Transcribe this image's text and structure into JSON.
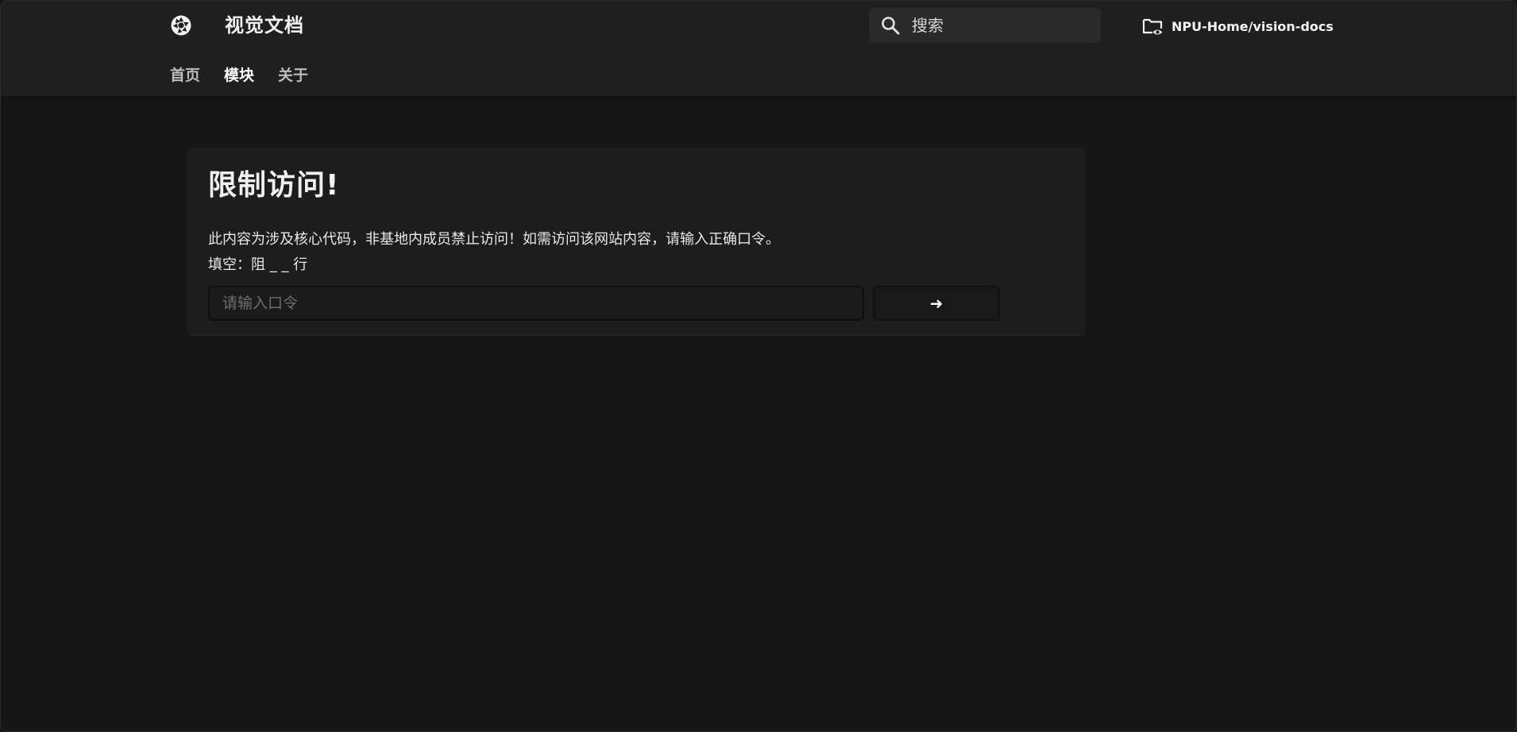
{
  "header": {
    "site_title": "视觉文档",
    "logo_icon": "aperture-icon",
    "search": {
      "label": "搜索",
      "icon": "search-icon"
    },
    "repo": {
      "label": "NPU-Home/vision-docs",
      "icon": "folder-eye-icon"
    }
  },
  "nav": {
    "items": [
      {
        "label": "首页",
        "active": false
      },
      {
        "label": "模块",
        "active": true
      },
      {
        "label": "关于",
        "active": false
      }
    ]
  },
  "access_card": {
    "title": "限制访问!",
    "description": "此内容为涉及核心代码，非基地内成员禁止访问！如需访问该网站内容，请输入正确口令。",
    "hint": "填空：阻 _ _ 行",
    "input_placeholder": "请输入口令",
    "input_value": "",
    "submit_label": "➜"
  },
  "colors": {
    "background": "#161616",
    "header": "#1f1f1f",
    "card": "#1d1d1d",
    "search_bg": "#2a2a2a"
  }
}
